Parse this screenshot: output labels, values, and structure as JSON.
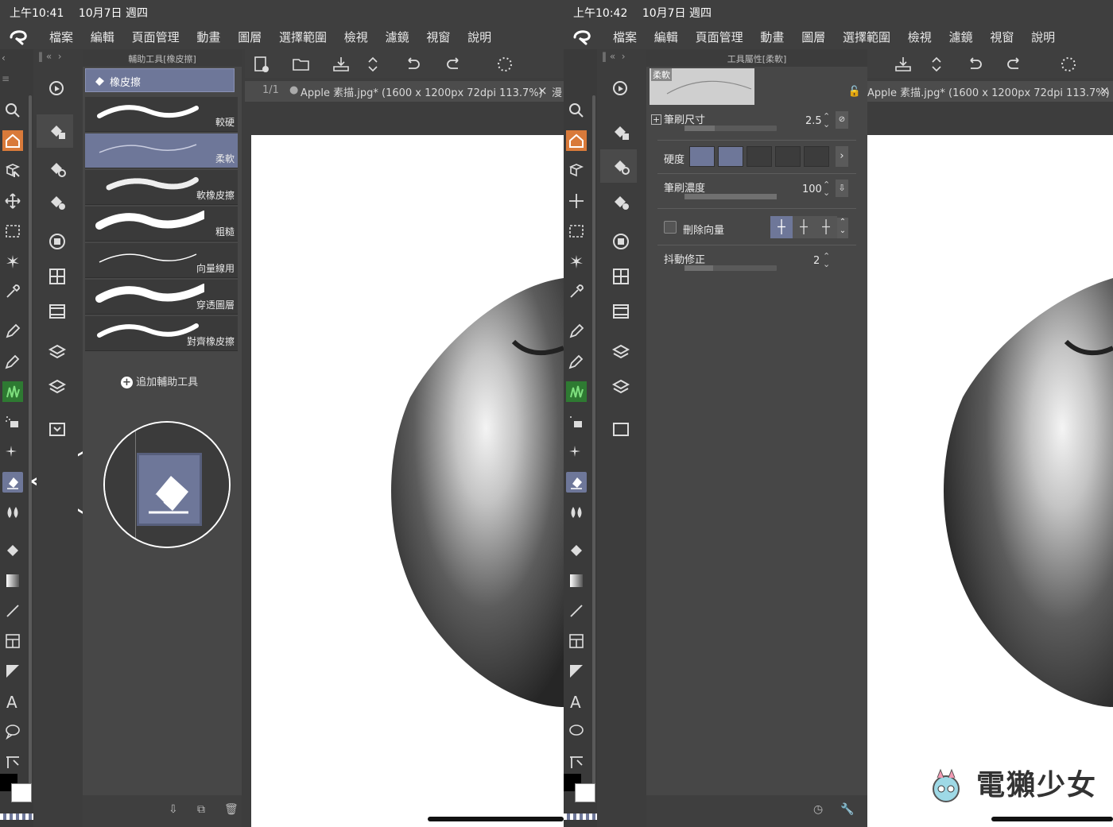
{
  "left": {
    "status": {
      "time": "上午10:41",
      "date": "10月7日 週四"
    },
    "menu": [
      "檔案",
      "編輯",
      "頁面管理",
      "動畫",
      "圖層",
      "選擇範圍",
      "檢視",
      "濾鏡",
      "視窗",
      "說明"
    ],
    "subtool_panel": {
      "header": "輔助工具[橡皮擦]",
      "selected_tool": "橡皮擦",
      "brushes": [
        {
          "label": "較硬",
          "selected": false
        },
        {
          "label": "柔軟",
          "selected": true
        },
        {
          "label": "軟橡皮擦",
          "selected": false
        },
        {
          "label": "粗糙",
          "selected": false
        },
        {
          "label": "向量線用",
          "selected": false
        },
        {
          "label": "穿透圖層",
          "selected": false
        },
        {
          "label": "對齊橡皮擦",
          "selected": false
        }
      ],
      "add_label": "追加輔助工具"
    },
    "tab": {
      "page": "1/1",
      "title": "Apple 素描.jpg* (1600 x 1200px 72dpi 113.7%)",
      "close": "×",
      "extra": "漫"
    }
  },
  "right": {
    "status": {
      "time": "上午10:42",
      "date": "10月7日 週四"
    },
    "menu": [
      "檔案",
      "編輯",
      "頁面管理",
      "動畫",
      "圖層",
      "選擇範圍",
      "檢視",
      "濾鏡",
      "視窗",
      "說明"
    ],
    "props_panel": {
      "header": "工具屬性[柔軟]",
      "preview_label": "柔軟",
      "brush_size": {
        "label": "筆刷尺寸",
        "value": "2.5"
      },
      "hardness": {
        "label": "硬度",
        "level": 2,
        "segments": 6
      },
      "brush_density": {
        "label": "筆刷濃度",
        "value": "100"
      },
      "delete_vector": {
        "label": "刪除向量",
        "checked": false
      },
      "stabilization": {
        "label": "抖動修正",
        "value": "2"
      }
    },
    "tab": {
      "title": "Apple 素描.jpg* (1600 x 1200px 72dpi 113.7%)",
      "close": "×"
    }
  },
  "watermark": "電獺少女",
  "colors": {
    "accent": "#6e7799",
    "panel": "#474747",
    "background": "#3d3d3d"
  }
}
